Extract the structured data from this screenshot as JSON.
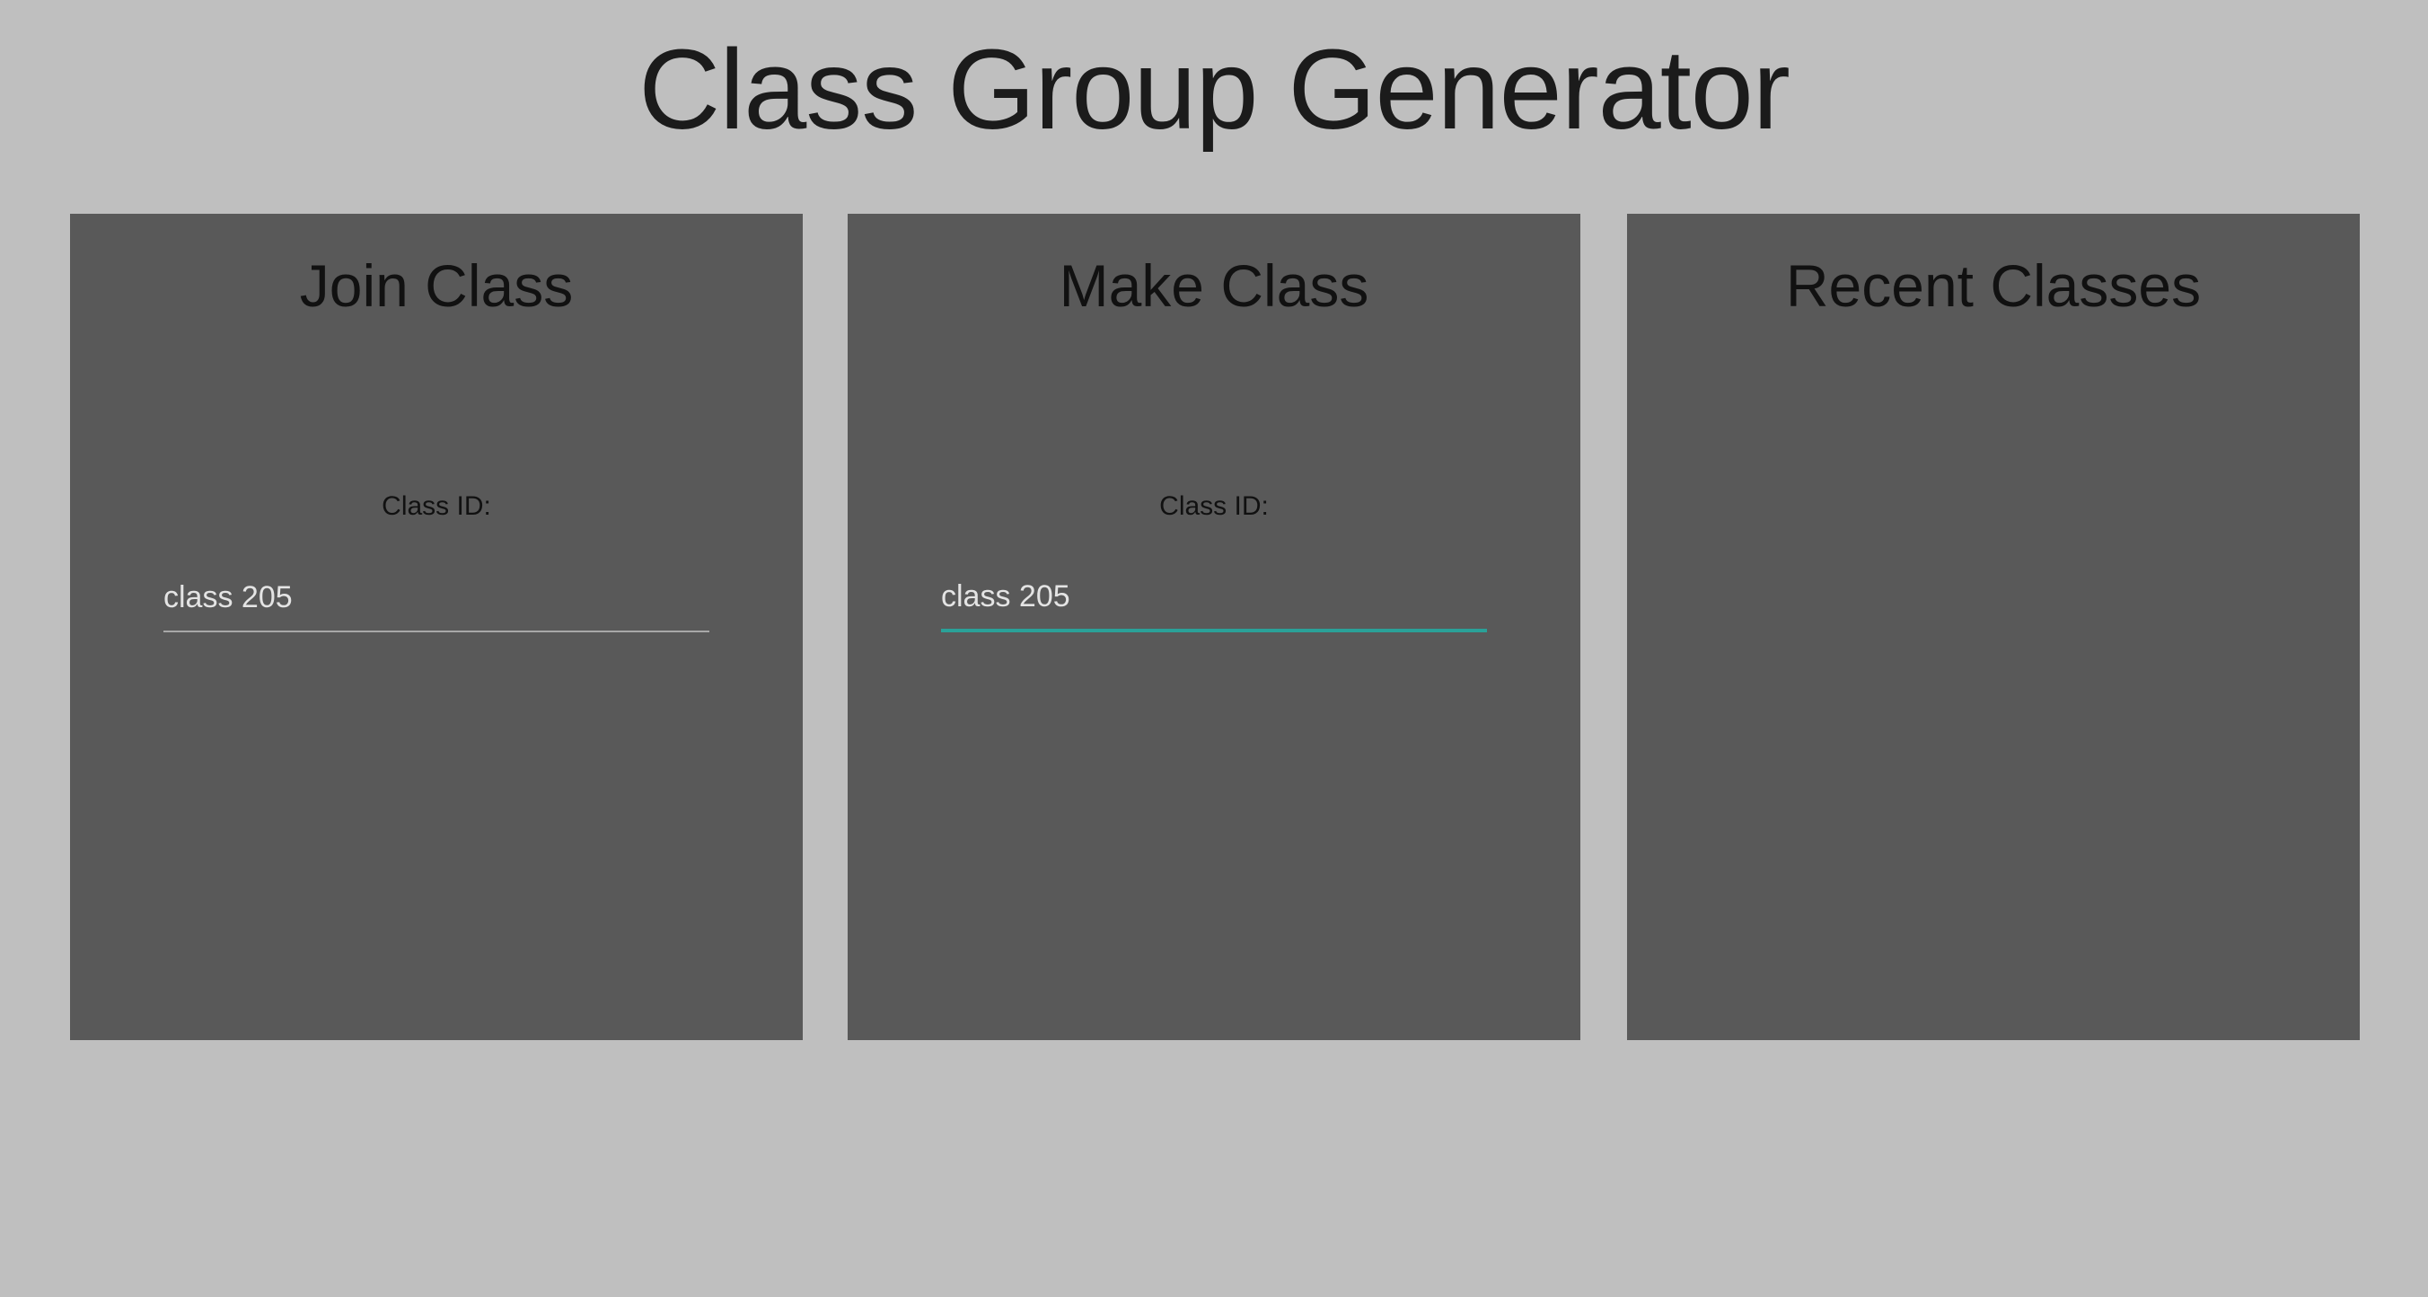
{
  "app": {
    "title": "Class Group Generator"
  },
  "panels": {
    "join": {
      "title": "Join Class",
      "field_label": "Class ID:",
      "input_value": "class 205"
    },
    "make": {
      "title": "Make Class",
      "field_label": "Class ID:",
      "input_value": "class 205",
      "focused": true
    },
    "recent": {
      "title": "Recent Classes",
      "items": []
    }
  },
  "colors": {
    "page_background": "#bfbfbf",
    "panel_background": "#595959",
    "focus_accent": "#2aa198",
    "input_underline": "#a8a8a8"
  }
}
